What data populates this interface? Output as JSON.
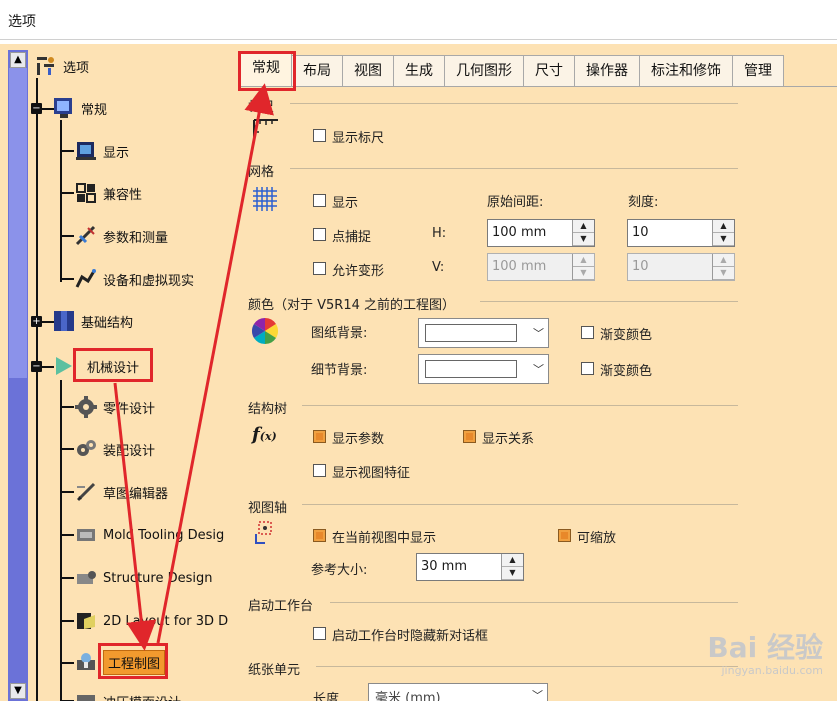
{
  "window": {
    "title": "选项"
  },
  "tree": {
    "items": [
      {
        "label": "选项",
        "icon": "options-tree-icon"
      },
      {
        "label": "常规",
        "icon": "general-icon"
      },
      {
        "label": "显示",
        "icon": "display-icon"
      },
      {
        "label": "兼容性",
        "icon": "compatibility-icon"
      },
      {
        "label": "参数和测量",
        "icon": "parameters-icon"
      },
      {
        "label": "设备和虚拟现实",
        "icon": "devices-icon"
      },
      {
        "label": "基础结构",
        "icon": "infrastructure-icon"
      },
      {
        "label": "机械设计",
        "icon": "mechanical-design-icon"
      },
      {
        "label": "零件设计",
        "icon": "part-design-icon"
      },
      {
        "label": "装配设计",
        "icon": "assembly-design-icon"
      },
      {
        "label": "草图编辑器",
        "icon": "sketcher-icon"
      },
      {
        "label": "Mold Tooling Desig",
        "icon": "mold-tooling-icon"
      },
      {
        "label": "Structure Design",
        "icon": "structure-design-icon"
      },
      {
        "label": "2D Layout for 3D D",
        "icon": "2d-layout-icon"
      },
      {
        "label": "工程制图",
        "icon": "drafting-icon"
      },
      {
        "label": "冲压模面设计",
        "icon": "die-face-icon"
      }
    ]
  },
  "tabs": [
    "常规",
    "布局",
    "视图",
    "生成",
    "几何图形",
    "尺寸",
    "操作器",
    "标注和修饰",
    "管理"
  ],
  "ruler": {
    "section": "标尺",
    "show_ruler": "显示标尺"
  },
  "grid": {
    "section": "网格",
    "show": "显示",
    "snap": "点捕捉",
    "allow_distortion": "允许变形",
    "primary_spacing": "原始间距:",
    "graduations": "刻度:",
    "h_label": "H:",
    "v_label": "V:",
    "h_spacing": "100 mm",
    "v_spacing": "100 mm",
    "h_graduation": "10",
    "v_graduation": "10"
  },
  "colors": {
    "section": "颜色（对于 V5R14 之前的工程图）",
    "sheet_background": "图纸背景:",
    "detail_background": "细节背景:",
    "gradient": "渐变颜色"
  },
  "tree_section": {
    "section": "结构树",
    "show_parameters": "显示参数",
    "show_relations": "显示关系",
    "show_view_features": "显示视图特征"
  },
  "view_axis": {
    "section": "视图轴",
    "show_in_current_view": "在当前视图中显示",
    "zoomable": "可缩放",
    "reference_size_label": "参考大小:",
    "reference_size": "30 mm"
  },
  "startup": {
    "section": "启动工作台",
    "hide_new_dialog": "启动工作台时隐藏新对话框"
  },
  "paper": {
    "section": "纸张单元",
    "length_label": "长度",
    "length_unit": "毫米 (mm)"
  },
  "watermark": {
    "main": "Bai 经验",
    "sub": "jingyan.baidu.com"
  }
}
